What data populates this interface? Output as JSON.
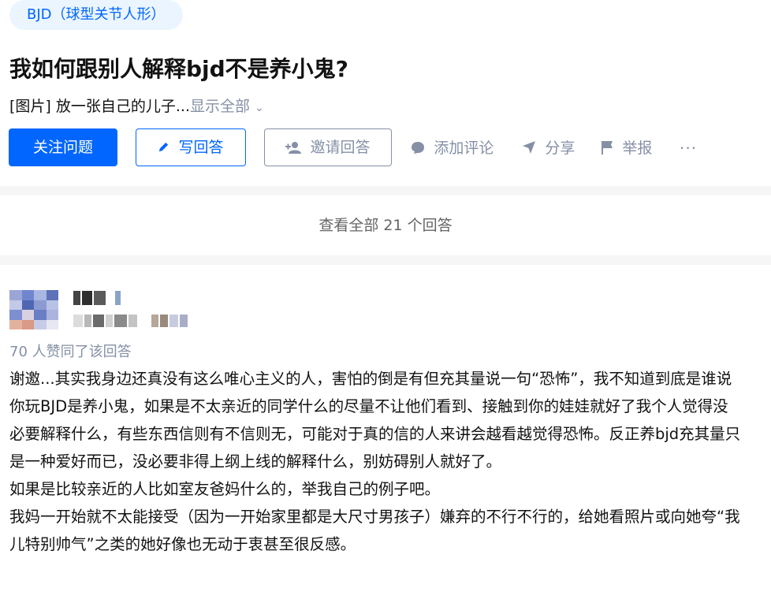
{
  "topic": {
    "label": "BJD（球型关节人形）"
  },
  "question": {
    "title": "我如何跟别人解释bjd不是养小鬼?",
    "excerpt": "[图片] 放一张自己的儿子...",
    "show_all": "显示全部"
  },
  "actions": {
    "follow": "关注问题",
    "write": "写回答",
    "invite": "邀请回答",
    "comment": "添加评论",
    "share": "分享",
    "report": "举报",
    "more": "···"
  },
  "view_all_answers": "查看全部 21 个回答",
  "answer": {
    "votes": "70 人赞同了该回答",
    "paragraphs": [
      "谢邀...其实我身边还真没有这么唯心主义的人，害怕的倒是有但充其量说一句“恐怖”，我不知道到底是谁说你玩BJD是养小鬼，如果是不太亲近的同学什么的尽量不让他们看到、接触到你的娃娃就好了我个人觉得没必要解释什么，有些东西信则有不信则无，可能对于真的信的人来讲会越看越觉得恐怖。反正养bjd充其量只是一种爱好而已，没必要非得上纲上线的解释什么，别妨碍别人就好了。",
      "如果是比较亲近的人比如室友爸妈什么的，举我自己的例子吧。",
      "我妈一开始就不太能接受（因为一开始家里都是大尺寸男孩子）嫌弃的不行不行的，给她看照片或向她夸“我儿特别帅气”之类的她好像也无动于衷甚至很反感。"
    ]
  },
  "colors": {
    "brand": "#0066ff",
    "muted": "#8590a6",
    "tag_bg": "#ebf5ff",
    "divider": "#f6f6f6"
  }
}
